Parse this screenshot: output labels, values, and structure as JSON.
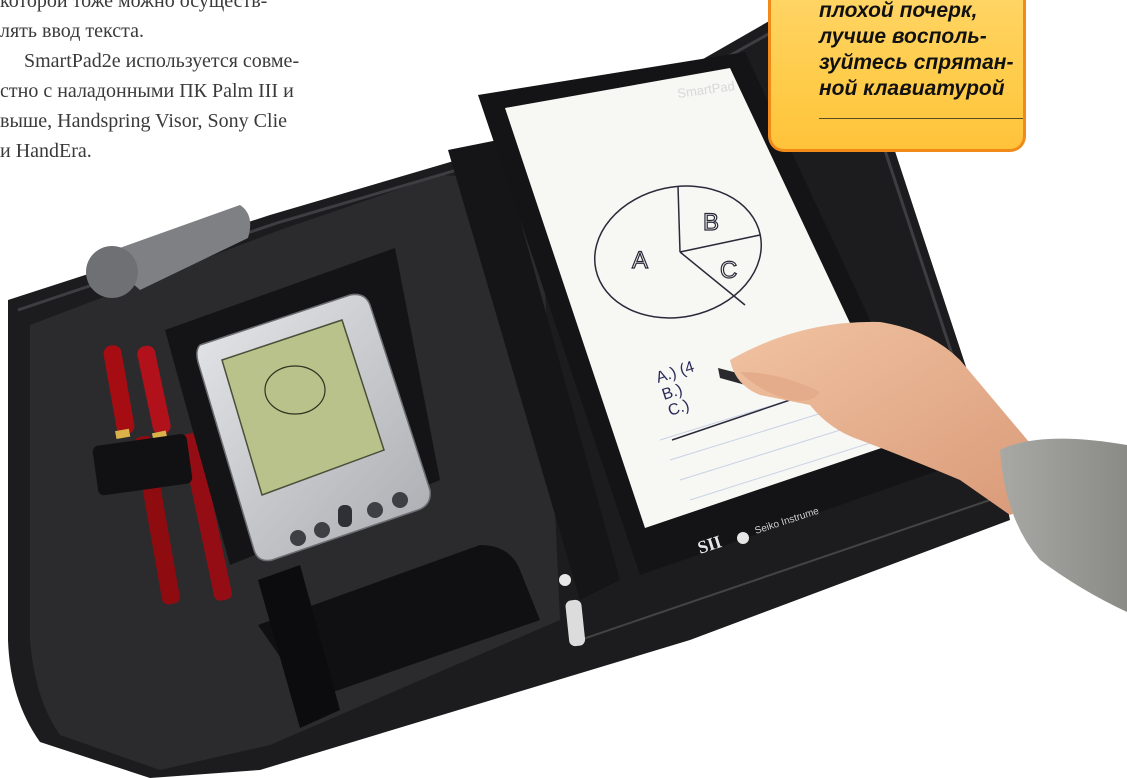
{
  "article": {
    "lines": [
      "которой тоже можно осуществ-",
      "лять ввод текста.",
      "SmartPad2e используется совме-",
      "стно с наладонными ПК Palm III и",
      "выше, Handspring Visor, Sony Clie",
      "и HandEra."
    ]
  },
  "callout": {
    "lines": [
      "плохой почерк,",
      "лучше восполь-",
      "зуйтесь спрятан-",
      "ной клавиатурой"
    ]
  },
  "photo": {
    "pad_brand": "SmartPad",
    "sii_brand": "SII",
    "seiko_brand": "Seiko Instrume",
    "sketch_labels": [
      "A",
      "B",
      "C"
    ],
    "sketch_answers": [
      "A.) (4",
      "B.)",
      "C.)"
    ],
    "colors": {
      "folio": "#1c1c1e",
      "paper": "#f7f7f4",
      "pen_red": "#a50d12",
      "pen_gold": "#d9b24a",
      "callout_fill": "#ffcc4a",
      "callout_border": "#f28a1a"
    }
  }
}
